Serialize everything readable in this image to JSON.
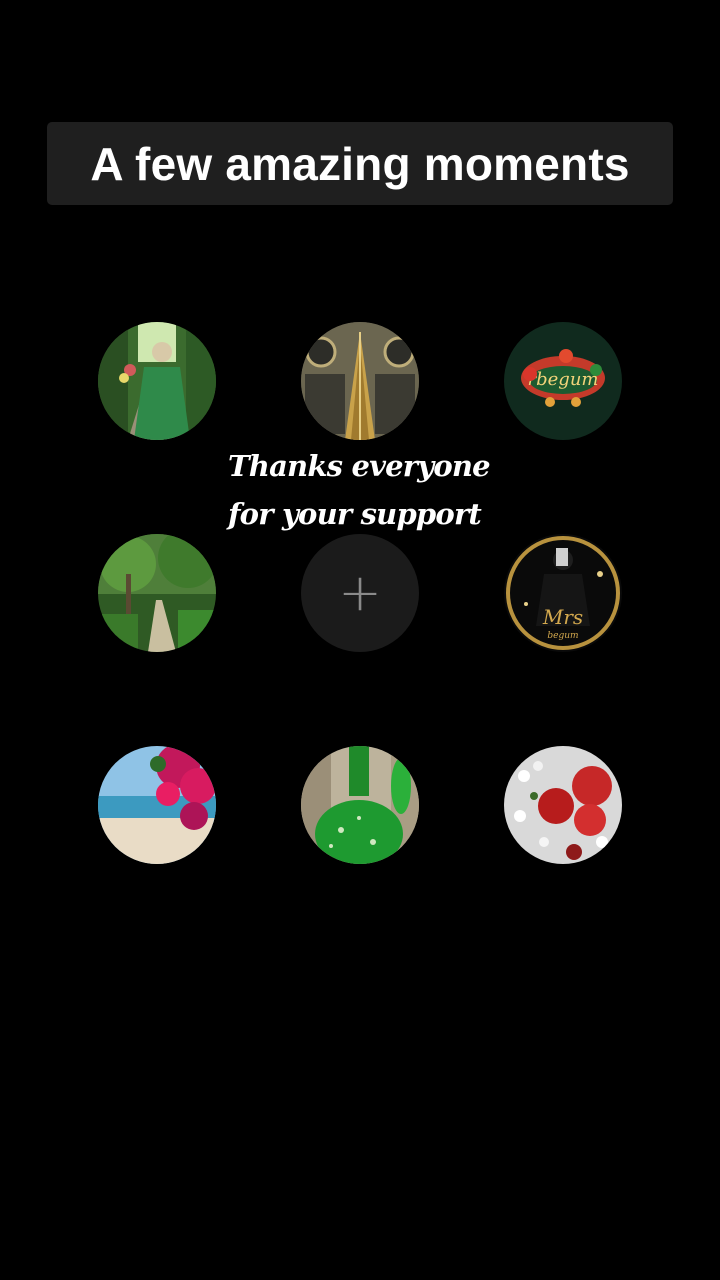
{
  "title": "A few amazing moments",
  "caption": {
    "line1": "Thanks everyone",
    "line2": "for your support"
  },
  "add_button": {
    "icon": "plus-icon",
    "glyph": "+"
  },
  "moments": [
    {
      "name": "moment-woman-green-dress"
    },
    {
      "name": "moment-kaaba-door"
    },
    {
      "name": "moment-logo-badge-1"
    },
    {
      "name": "moment-forest-path"
    },
    {
      "name": "moment-logo-badge-2"
    },
    {
      "name": "moment-beach-flowers"
    },
    {
      "name": "moment-green-vase"
    },
    {
      "name": "moment-red-roses"
    }
  ],
  "colors": {
    "background": "#000000",
    "banner": "#1f1f1f",
    "text": "#ffffff",
    "add_circle": "#1b1b1b",
    "plus": "#8a8a8a"
  }
}
